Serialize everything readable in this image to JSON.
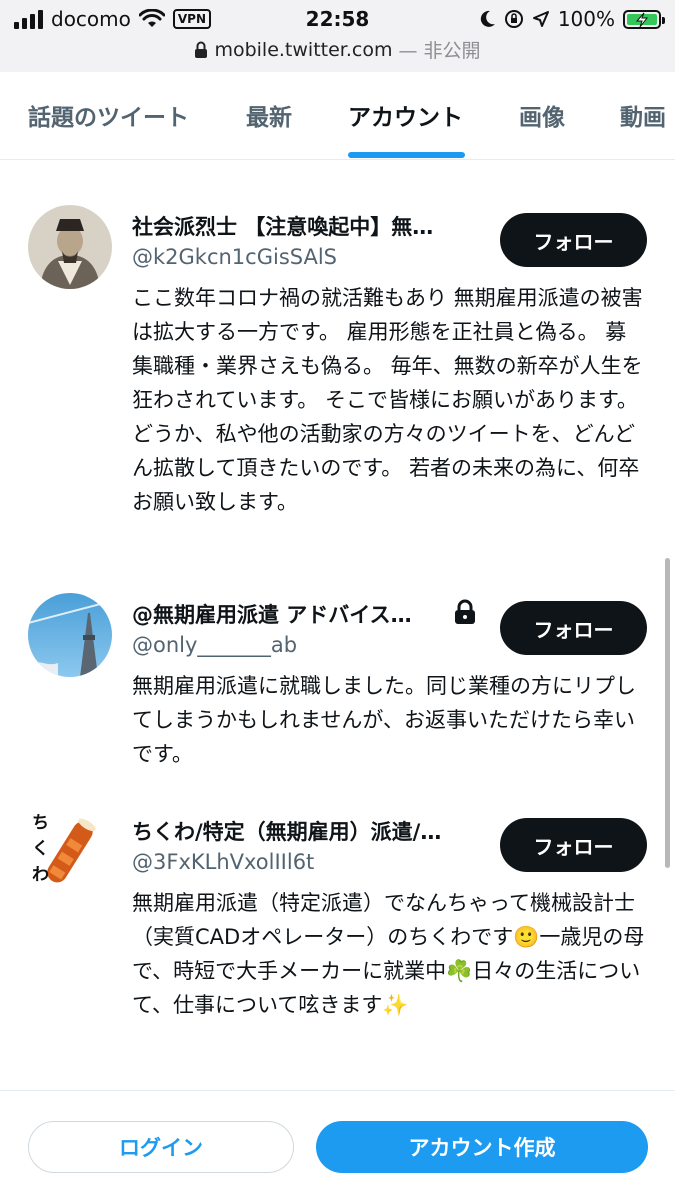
{
  "status_bar": {
    "carrier": "docomo",
    "vpn": "VPN",
    "time": "22:58",
    "battery": "100%"
  },
  "url_bar": {
    "host": "mobile.twitter.com",
    "privacy": "— 非公開"
  },
  "tabs": [
    {
      "label": "話題のツイート",
      "active": false
    },
    {
      "label": "最新",
      "active": false
    },
    {
      "label": "アカウント",
      "active": true
    },
    {
      "label": "画像",
      "active": false
    },
    {
      "label": "動画",
      "active": false
    }
  ],
  "accounts": [
    {
      "name": "社会派烈士 【注意喚起中】無…",
      "handle": "@k2Gkcn1cGisSAlS",
      "follow_label": "フォロー",
      "bio": "ここ数年コロナ禍の就活難もあり 無期雇用派遣の被害は拡大する一方です。 雇用形態を正社員と偽る。 募集職種・業界さえも偽る。 毎年、無数の新卒が人生を狂わされています。 そこで皆様にお願いがあります。どうか、私や他の活動家の方々のツイートを、どんどん拡散して頂きたいのです。 若者の未来の為に、何卒お願い致します。"
    },
    {
      "name": "@無期雇用派遣 アドバイス…",
      "handle": "@only_______ab",
      "follow_label": "フォロー",
      "bio": "無期雇用派遣に就職しました。同じ業種の方にリプしてしまうかもしれませんが、お返事いただけたら幸いです。"
    },
    {
      "name": "ちくわ/特定（無期雇用）派遣/…",
      "handle": "@3FxKLhVxolIIl6t",
      "follow_label": "フォロー",
      "bio": "無期雇用派遣（特定派遣）でなんちゃって機械設計士（実質CADオペレーター）のちくわです🙂一歳児の母で、時短で大手メーカーに就業中☘️日々の生活について、仕事について呟きます✨",
      "avatar_text": "ちくわ"
    }
  ],
  "bottom": {
    "login_label": "ログイン",
    "signup_label": "アカウント作成"
  },
  "colors": {
    "accent": "#1d9bf0",
    "follow_button": "#0f1419",
    "secondary_text": "#536471"
  }
}
